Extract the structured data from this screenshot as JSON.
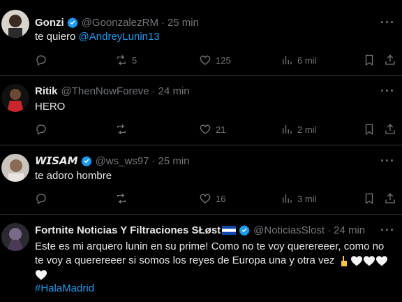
{
  "tweets": [
    {
      "name": "Gonzi",
      "verified": true,
      "handle": "@GoonzalezRM",
      "time": "25 min",
      "text_prefix": "te quiero ",
      "mention": "@AndreyLunin13",
      "retweets": "5",
      "likes": "125",
      "views": "6 mil"
    },
    {
      "name": "Ritik",
      "verified": false,
      "handle": "@ThenNowForeve",
      "time": "24 min",
      "text": "HERO",
      "retweets": "",
      "likes": "21",
      "views": "2 mil"
    },
    {
      "name": "𝙒𝙄𝙎𝘼𝙈",
      "verified": true,
      "handle": "@ws_ws97",
      "time": "25 min",
      "text": "te adoro hombre",
      "retweets": "",
      "likes": "16",
      "views": "3 mil"
    },
    {
      "name": "Fortnite Noticias Y Filtraciones SŁøst",
      "verified": true,
      "handle": "@NoticiasSlost",
      "time": "24 min",
      "text_line1": "Este es mi arquero lunin en su prime! Como no te voy querereeer, como no",
      "text_line2": "te voy a querereeer si somos los reyes de Europa una y otra vez",
      "hashtag": "#HalaMadrid"
    }
  ],
  "dot": "·",
  "more": "···",
  "icons": [
    "reply-icon",
    "retweet-icon",
    "like-icon",
    "views-icon",
    "bookmark-icon",
    "share-icon",
    "verified-icon"
  ],
  "colors": {
    "background": "#000000",
    "text": "#e7e9ea",
    "muted": "#71767b",
    "accent": "#1d9bf0",
    "border": "#2f3336"
  }
}
